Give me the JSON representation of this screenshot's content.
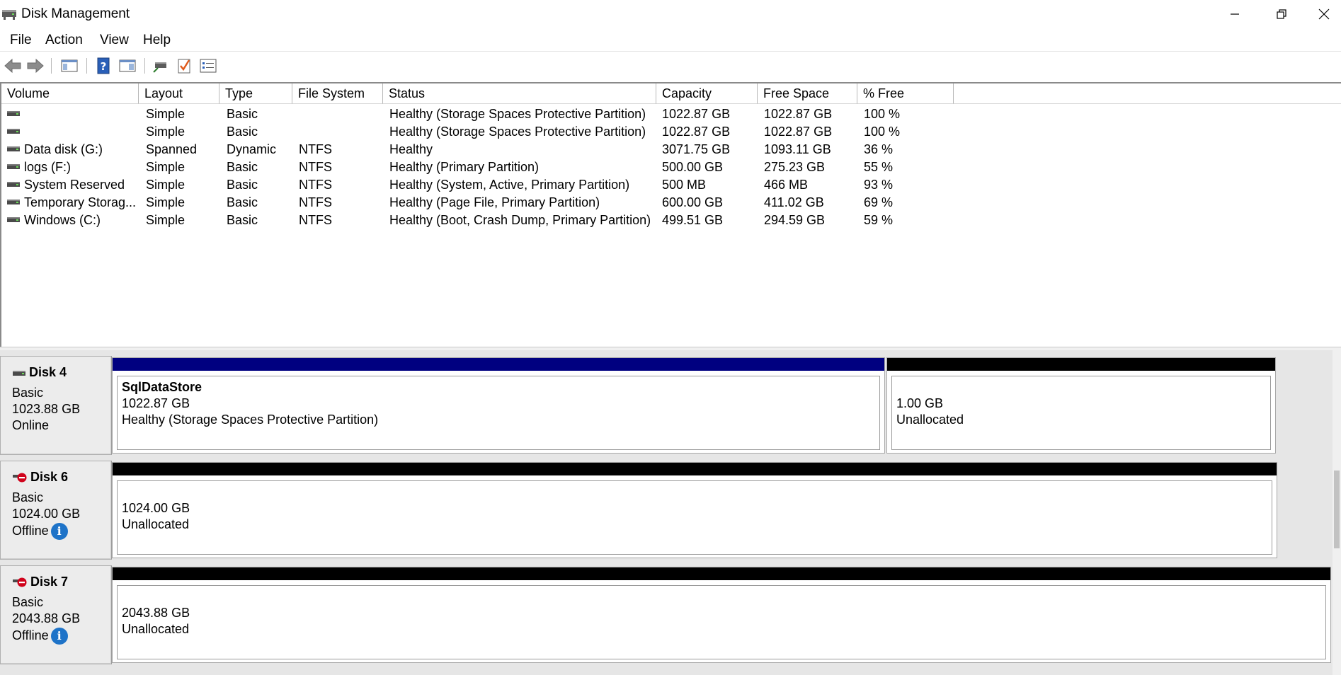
{
  "window": {
    "title": "Disk Management",
    "controls": {
      "minimize": "minimize-icon",
      "restore": "restore-icon",
      "close": "close-icon"
    }
  },
  "menu": [
    "File",
    "Action",
    "View",
    "Help"
  ],
  "toolbar": {
    "icons": [
      "back-arrow-icon",
      "forward-arrow-icon",
      "show-hide-console-tree-icon",
      "help-icon",
      "properties-pane-icon",
      "connect-icon",
      "checkmark-icon",
      "list-view-icon"
    ]
  },
  "volumes": {
    "columns": [
      "Volume",
      "Layout",
      "Type",
      "File System",
      "Status",
      "Capacity",
      "Free Space",
      "% Free"
    ],
    "rows": [
      {
        "volume": "",
        "layout": "Simple",
        "type": "Basic",
        "fs": "",
        "status": "Healthy (Storage Spaces Protective Partition)",
        "capacity": "1022.87 GB",
        "free": "1022.87 GB",
        "pct": "100 %"
      },
      {
        "volume": "",
        "layout": "Simple",
        "type": "Basic",
        "fs": "",
        "status": "Healthy (Storage Spaces Protective Partition)",
        "capacity": "1022.87 GB",
        "free": "1022.87 GB",
        "pct": "100 %"
      },
      {
        "volume": "Data disk (G:)",
        "layout": "Spanned",
        "type": "Dynamic",
        "fs": "NTFS",
        "status": "Healthy",
        "capacity": "3071.75 GB",
        "free": "1093.11 GB",
        "pct": "36 %"
      },
      {
        "volume": "logs (F:)",
        "layout": "Simple",
        "type": "Basic",
        "fs": "NTFS",
        "status": "Healthy (Primary Partition)",
        "capacity": "500.00 GB",
        "free": "275.23 GB",
        "pct": "55 %"
      },
      {
        "volume": "System Reserved",
        "layout": "Simple",
        "type": "Basic",
        "fs": "NTFS",
        "status": "Healthy (System, Active, Primary Partition)",
        "capacity": "500 MB",
        "free": "466 MB",
        "pct": "93 %"
      },
      {
        "volume": "Temporary Storag...",
        "layout": "Simple",
        "type": "Basic",
        "fs": "NTFS",
        "status": "Healthy (Page File, Primary Partition)",
        "capacity": "600.00 GB",
        "free": "411.02 GB",
        "pct": "69 %"
      },
      {
        "volume": "Windows (C:)",
        "layout": "Simple",
        "type": "Basic",
        "fs": "NTFS",
        "status": "Healthy (Boot, Crash Dump, Primary Partition)",
        "capacity": "499.51 GB",
        "free": "294.59 GB",
        "pct": "59 %"
      }
    ]
  },
  "disks": [
    {
      "name": "Disk 4",
      "type": "Basic",
      "size": "1023.88 GB",
      "state": "Online",
      "offline": false,
      "partitions": [
        {
          "label": "SqlDataStore",
          "size": "1022.87 GB",
          "status": "Healthy (Storage Spaces Protective Partition)",
          "bar_color": "#000080"
        },
        {
          "label": "",
          "size": "1.00 GB",
          "status": "Unallocated",
          "bar_color": "#000000"
        }
      ]
    },
    {
      "name": "Disk 6",
      "type": "Basic",
      "size": "1024.00 GB",
      "state": "Offline",
      "offline": true,
      "partitions": [
        {
          "label": "",
          "size": "1024.00 GB",
          "status": "Unallocated",
          "bar_color": "#000000"
        }
      ]
    },
    {
      "name": "Disk 7",
      "type": "Basic",
      "size": "2043.88 GB",
      "state": "Offline",
      "offline": true,
      "partitions": [
        {
          "label": "",
          "size": "2043.88 GB",
          "status": "Unallocated",
          "bar_color": "#000000"
        }
      ]
    }
  ],
  "colors": {
    "primary_partition_bar": "#000080",
    "unallocated_bar": "#000000",
    "info_icon": "#1e73c8",
    "offline_badge": "#d0021b"
  }
}
